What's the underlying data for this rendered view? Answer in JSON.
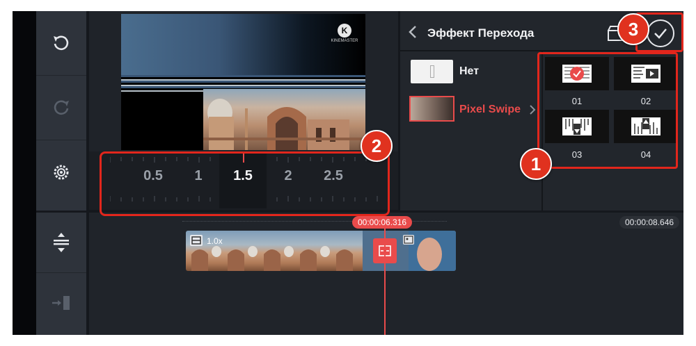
{
  "left_toolbar": {
    "undo_icon": "undo-icon",
    "redo_icon": "redo-icon",
    "settings_icon": "settings-icon",
    "expand_icon": "expand-vertical-icon",
    "export_icon": "export-to-track-icon"
  },
  "preview": {
    "watermark": "KINEMASTER"
  },
  "scrubber": {
    "ticks": [
      "0.5",
      "1",
      "1.5",
      "2",
      "2.5"
    ],
    "selected": "1.5"
  },
  "panel": {
    "title": "Эффект Перехода",
    "none_label": "Нет",
    "effect_label": "Pixel Swipe",
    "thumbnails": [
      {
        "label": "01",
        "selected": true
      },
      {
        "label": "02",
        "selected": false
      },
      {
        "label": "03",
        "selected": false
      },
      {
        "label": "04",
        "selected": false
      }
    ]
  },
  "timeline": {
    "playhead_time": "00:00:06.316",
    "total_time": "00:00:08.646",
    "clip_speed": "1.0x"
  },
  "annotations": {
    "badge_1": "1",
    "badge_2": "2",
    "badge_3": "3"
  },
  "colors": {
    "accent": "#e94b4b",
    "annotation_red": "#e2261c"
  }
}
